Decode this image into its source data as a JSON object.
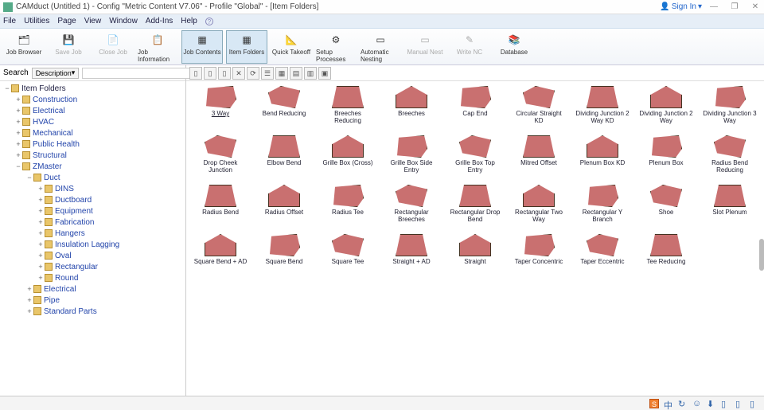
{
  "titlebar": {
    "title": "CAMduct (Untitled 1) - Config \"Metric Content V7.06\" - Profile \"Global\" - [Item Folders]",
    "signin": "Sign In",
    "min": "—",
    "restore": "❐",
    "close": "✕"
  },
  "menubar": [
    "File",
    "Utilities",
    "Page",
    "View",
    "Window",
    "Add-Ins",
    "Help"
  ],
  "toolbar": [
    {
      "label": "Job Browser",
      "icon": "🗂",
      "active": false,
      "disabled": false
    },
    {
      "label": "Save Job",
      "icon": "💾",
      "active": false,
      "disabled": true
    },
    {
      "label": "Close Job",
      "icon": "📄",
      "active": false,
      "disabled": true
    },
    {
      "label": "Job Information",
      "icon": "📋",
      "active": false,
      "disabled": false
    },
    {
      "label": "Job Contents",
      "icon": "▦",
      "active": true,
      "disabled": false
    },
    {
      "label": "Item Folders",
      "icon": "▦",
      "active": true,
      "disabled": false
    },
    {
      "label": "Quick Takeoff",
      "icon": "📐",
      "active": false,
      "disabled": false
    },
    {
      "label": "Setup Processes",
      "icon": "⚙",
      "active": false,
      "disabled": false
    },
    {
      "label": "Automatic Nesting",
      "icon": "▭",
      "active": false,
      "disabled": false
    },
    {
      "label": "Manual Nest",
      "icon": "▭",
      "active": false,
      "disabled": true
    },
    {
      "label": "Write NC",
      "icon": "✎",
      "active": false,
      "disabled": true
    },
    {
      "label": "Database",
      "icon": "📚",
      "active": false,
      "disabled": false
    }
  ],
  "search": {
    "label": "Search",
    "dropdown": "Description",
    "go": "⟳"
  },
  "tree": [
    {
      "indent": 0,
      "exp": "−",
      "label": "Item Folders",
      "blue": false
    },
    {
      "indent": 1,
      "exp": "+",
      "label": "Construction",
      "blue": true
    },
    {
      "indent": 1,
      "exp": "+",
      "label": "Electrical",
      "blue": true
    },
    {
      "indent": 1,
      "exp": "+",
      "label": "HVAC",
      "blue": true
    },
    {
      "indent": 1,
      "exp": "+",
      "label": "Mechanical",
      "blue": true
    },
    {
      "indent": 1,
      "exp": "+",
      "label": "Public Health",
      "blue": true
    },
    {
      "indent": 1,
      "exp": "+",
      "label": "Structural",
      "blue": true
    },
    {
      "indent": 1,
      "exp": "−",
      "label": "ZMaster",
      "blue": true
    },
    {
      "indent": 2,
      "exp": "−",
      "label": "Duct",
      "blue": true
    },
    {
      "indent": 3,
      "exp": "+",
      "label": "DINS",
      "blue": true
    },
    {
      "indent": 3,
      "exp": "+",
      "label": "Ductboard",
      "blue": true
    },
    {
      "indent": 3,
      "exp": "+",
      "label": "Equipment",
      "blue": true
    },
    {
      "indent": 3,
      "exp": "+",
      "label": "Fabrication",
      "blue": true
    },
    {
      "indent": 3,
      "exp": "+",
      "label": "Hangers",
      "blue": true
    },
    {
      "indent": 3,
      "exp": "+",
      "label": "Insulation Lagging",
      "blue": true
    },
    {
      "indent": 3,
      "exp": "+",
      "label": "Oval",
      "blue": true
    },
    {
      "indent": 3,
      "exp": "+",
      "label": "Rectangular",
      "blue": true,
      "sel": false
    },
    {
      "indent": 3,
      "exp": "+",
      "label": "Round",
      "blue": true
    },
    {
      "indent": 2,
      "exp": "+",
      "label": "Electrical",
      "blue": true
    },
    {
      "indent": 2,
      "exp": "+",
      "label": "Pipe",
      "blue": true
    },
    {
      "indent": 2,
      "exp": "+",
      "label": "Standard Parts",
      "blue": true
    }
  ],
  "main_toolbar_icons": [
    "▯",
    "▯",
    "▯",
    "✕",
    "⟳",
    "☰",
    "▦",
    "▤",
    "▥",
    "▣"
  ],
  "items": [
    {
      "label": "3 Way",
      "sel": true
    },
    {
      "label": "Bend Reducing"
    },
    {
      "label": "Breeches Reducing"
    },
    {
      "label": "Breeches"
    },
    {
      "label": "Cap End"
    },
    {
      "label": "Circular Straight KD"
    },
    {
      "label": "Dividing Junction 2 Way KD"
    },
    {
      "label": "Dividing Junction 2 Way"
    },
    {
      "label": "Dividing Junction 3 Way"
    },
    {
      "label": "Drop Cheek Junction"
    },
    {
      "label": "Elbow Bend"
    },
    {
      "label": "Grille Box (Cross)"
    },
    {
      "label": "Grille Box Side Entry"
    },
    {
      "label": "Grille Box Top Entry"
    },
    {
      "label": "Mitred Offset"
    },
    {
      "label": "Plenum Box KD"
    },
    {
      "label": "Plenum Box"
    },
    {
      "label": "Radius Bend Reducing"
    },
    {
      "label": "Radius Bend"
    },
    {
      "label": "Radius Offset"
    },
    {
      "label": "Radius Tee"
    },
    {
      "label": "Rectangular Breeches"
    },
    {
      "label": "Rectangular Drop Bend"
    },
    {
      "label": "Rectangular Two Way"
    },
    {
      "label": "Rectangular Y Branch"
    },
    {
      "label": "Shoe"
    },
    {
      "label": "Slot Plenum"
    },
    {
      "label": "Square Bend + AD"
    },
    {
      "label": "Square Bend"
    },
    {
      "label": "Square Tee"
    },
    {
      "label": "Straight + AD"
    },
    {
      "label": "Straight"
    },
    {
      "label": "Taper Concentric"
    },
    {
      "label": "Taper Eccentric"
    },
    {
      "label": "Tee Reducing"
    }
  ],
  "tray": [
    "S",
    "中",
    "↻",
    "☺",
    "⬇",
    "▯",
    "▯",
    "▯"
  ]
}
